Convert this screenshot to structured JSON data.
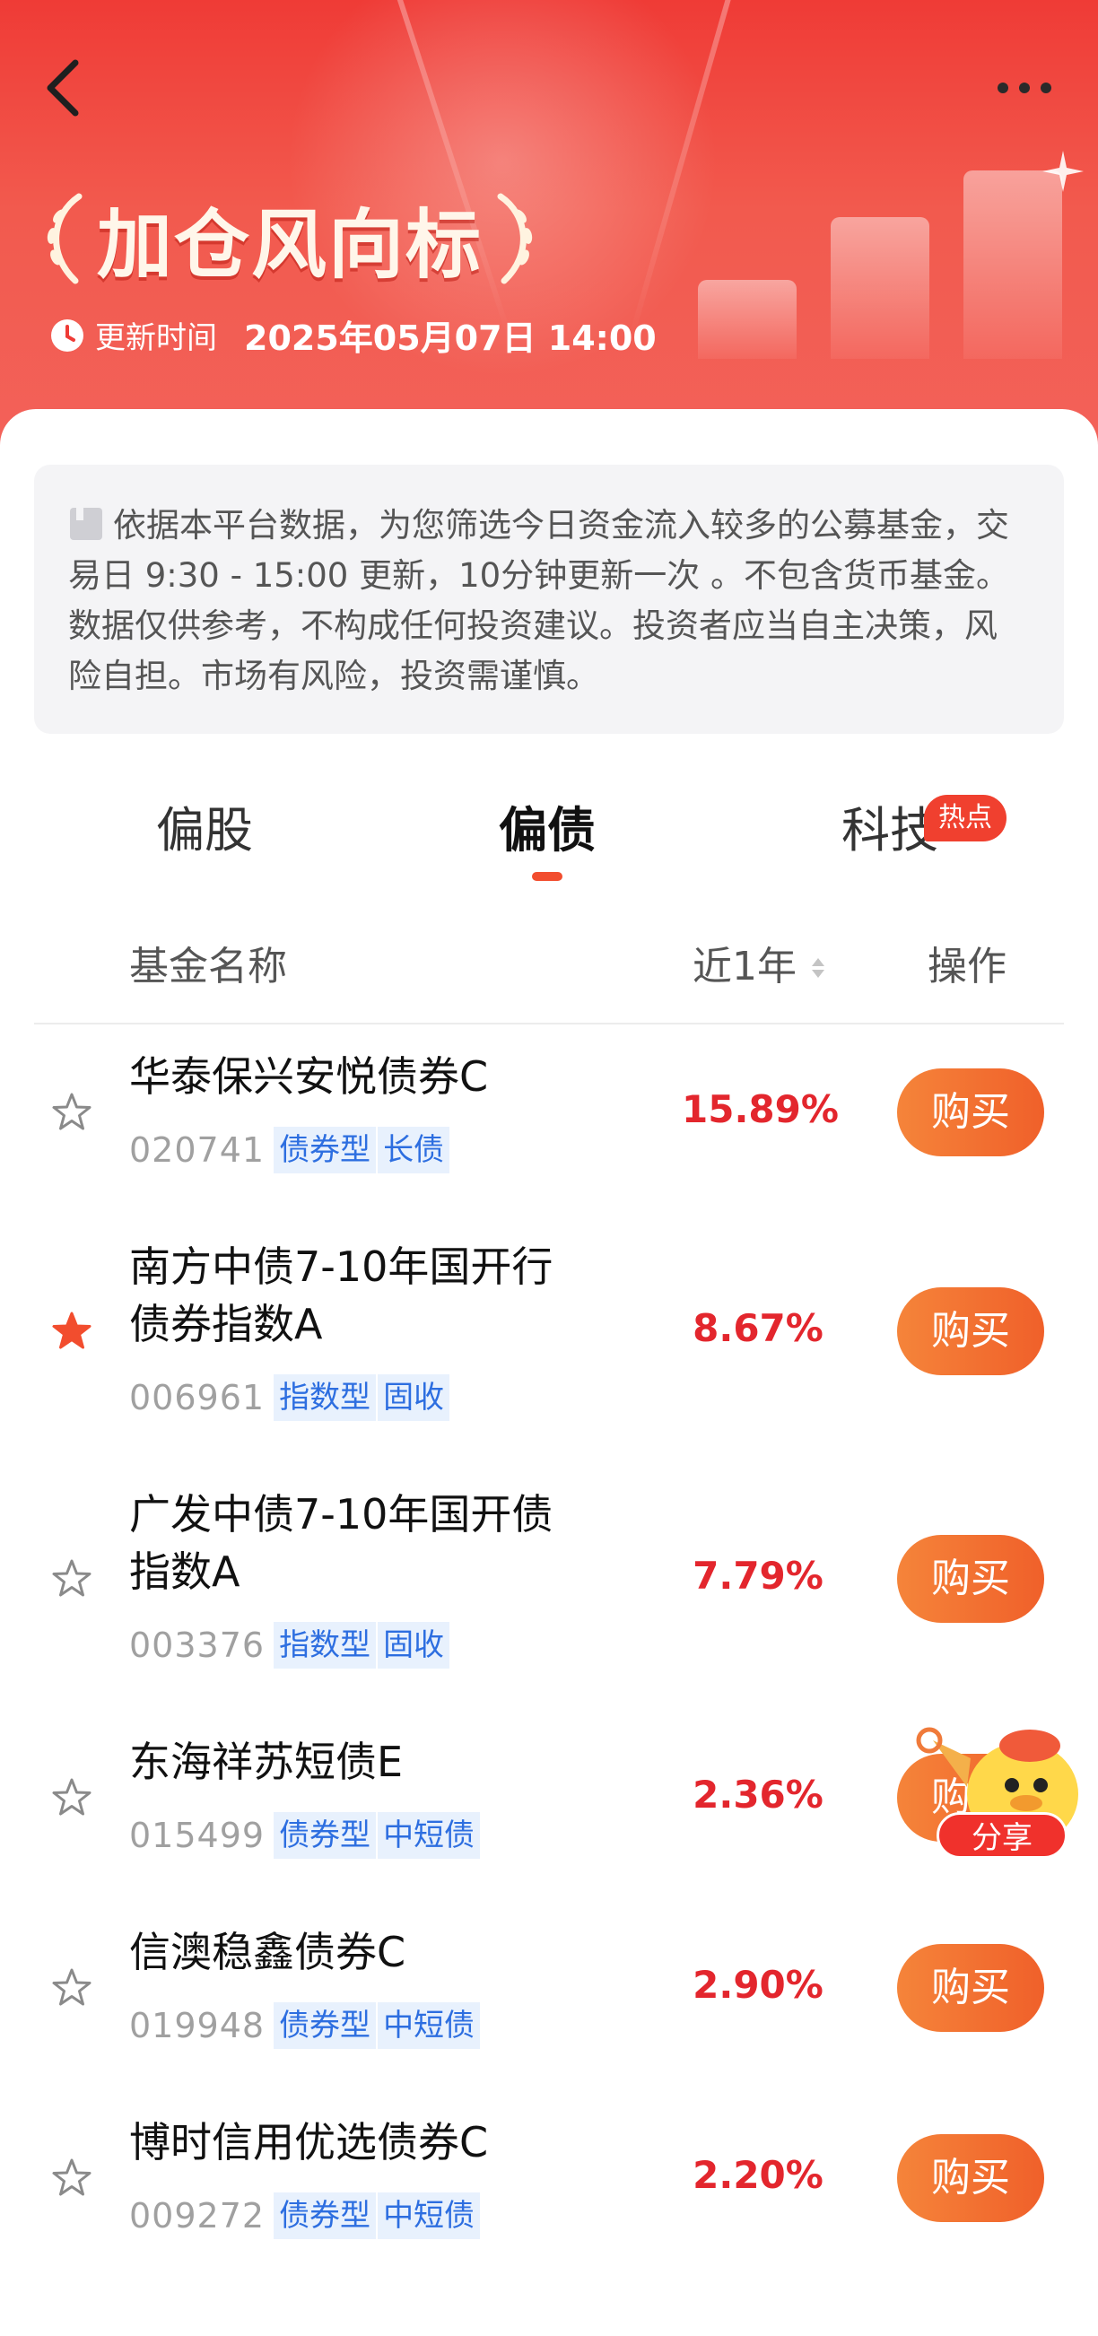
{
  "header": {
    "title": "加仓风向标",
    "update_label": "更新时间",
    "update_time": "2025年05月07日 14:00"
  },
  "notice": {
    "text": "依据本平台数据，为您筛选今日资金流入较多的公募基金，交易日 9:30 - 15:00 更新，10分钟更新一次 。不包含货币基金。数据仅供参考，不构成任何投资建议。投资者应当自主决策，风险自担。市场有风险，投资需谨慎。"
  },
  "tabs": [
    {
      "label": "偏股",
      "active": false
    },
    {
      "label": "偏债",
      "active": true
    },
    {
      "label": "科技",
      "active": false,
      "badge": "热点"
    }
  ],
  "table": {
    "col_name": "基金名称",
    "col_return": "近1年",
    "col_action": "操作"
  },
  "funds": [
    {
      "name_lines": [
        "华泰保兴安悦债券C"
      ],
      "code": "020741",
      "tags": [
        "债券型",
        "长债"
      ],
      "return": "15.89%",
      "starred": false,
      "action": "购买"
    },
    {
      "name_lines": [
        "南方中债7-10年国开行",
        "债券指数A"
      ],
      "code": "006961",
      "tags": [
        "指数型",
        "固收"
      ],
      "return": "8.67%",
      "starred": true,
      "action": "购买"
    },
    {
      "name_lines": [
        "广发中债7-10年国开债",
        "指数A"
      ],
      "code": "003376",
      "tags": [
        "指数型",
        "固收"
      ],
      "return": "7.79%",
      "starred": false,
      "action": "购买"
    },
    {
      "name_lines": [
        "东海祥苏短债E"
      ],
      "code": "015499",
      "tags": [
        "债券型",
        "中短债"
      ],
      "return": "2.36%",
      "starred": false,
      "action": "购买"
    },
    {
      "name_lines": [
        "信澳稳鑫债券C"
      ],
      "code": "019948",
      "tags": [
        "债券型",
        "中短债"
      ],
      "return": "2.90%",
      "starred": false,
      "action": "购买"
    },
    {
      "name_lines": [
        "博时信用优选债券C"
      ],
      "code": "009272",
      "tags": [
        "债券型",
        "中短债"
      ],
      "return": "2.20%",
      "starred": false,
      "action": "购买"
    }
  ],
  "share": {
    "label": "分享"
  },
  "colors": {
    "header_red": "#ef3b36",
    "return_red": "#e3262d",
    "buy_orange": "#f26a2e",
    "tag_blue": "#2d6ee0",
    "star_active": "#f24d2e"
  }
}
